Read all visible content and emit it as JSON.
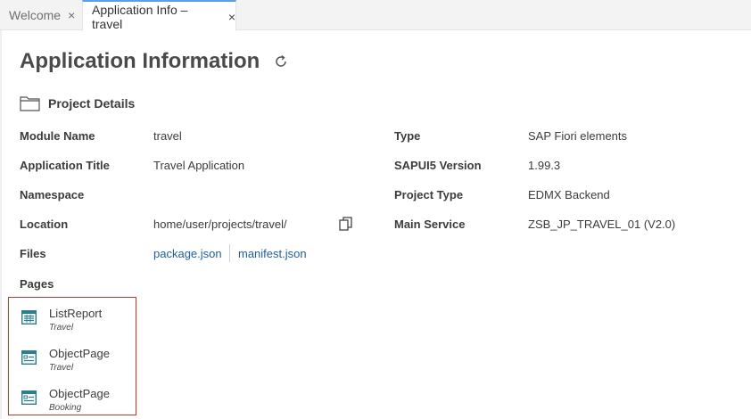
{
  "tabs": [
    {
      "label": "Welcome",
      "active": false
    },
    {
      "label": "Application Info – travel",
      "active": true
    }
  ],
  "tab_close_glyph": "×",
  "page": {
    "title": "Application Information"
  },
  "section": {
    "title": "Project Details"
  },
  "details": {
    "module_name": {
      "label": "Module Name",
      "value": "travel"
    },
    "application_title": {
      "label": "Application Title",
      "value": "Travel Application"
    },
    "namespace": {
      "label": "Namespace",
      "value": ""
    },
    "location": {
      "label": "Location",
      "value": "home/user/projects/travel/"
    },
    "files": {
      "label": "Files",
      "links": [
        "package.json",
        "manifest.json"
      ]
    },
    "type": {
      "label": "Type",
      "value": "SAP Fiori elements"
    },
    "sapui5_version": {
      "label": "SAPUI5 Version",
      "value": "1.99.3"
    },
    "project_type": {
      "label": "Project Type",
      "value": "EDMX Backend"
    },
    "main_service": {
      "label": "Main Service",
      "value": "ZSB_JP_TRAVEL_01 (V2.0)"
    }
  },
  "pages": {
    "label": "Pages",
    "items": [
      {
        "name": "ListReport",
        "entity": "Travel",
        "icon": "list-report-icon"
      },
      {
        "name": "ObjectPage",
        "entity": "Travel",
        "icon": "object-page-icon"
      },
      {
        "name": "ObjectPage",
        "entity": "Booking",
        "icon": "object-page-icon"
      }
    ]
  },
  "colors": {
    "accent": "#5aa0e6",
    "link": "#1f5f9e",
    "highlight_border": "#c0392b",
    "icon_teal": "#2e7d8c"
  }
}
